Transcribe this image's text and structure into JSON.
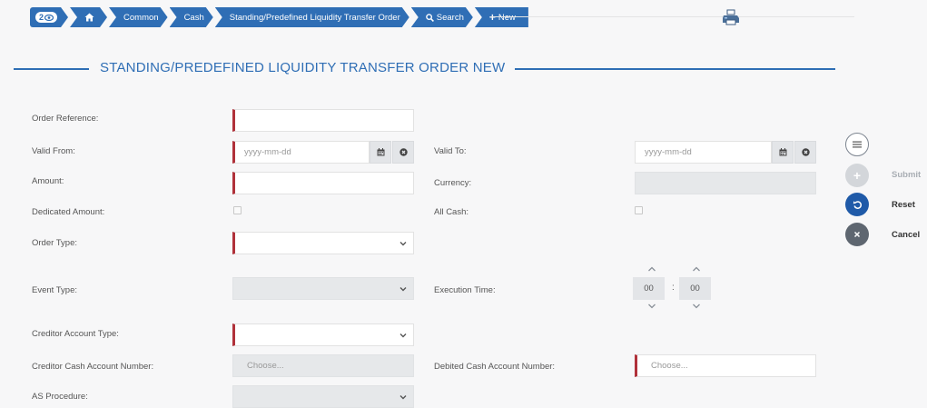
{
  "breadcrumb": {
    "counter": "2",
    "items": [
      "Common",
      "Cash",
      "Standing/Predefined Liquidity Transfer Order",
      "Search",
      "New"
    ]
  },
  "page": {
    "title": "STANDING/PREDEFINED LIQUIDITY TRANSFER ORDER NEW"
  },
  "form": {
    "order_reference": {
      "label": "Order Reference:",
      "value": ""
    },
    "valid_from": {
      "label": "Valid From:",
      "placeholder": "yyyy-mm-dd"
    },
    "valid_to": {
      "label": "Valid To:",
      "placeholder": "yyyy-mm-dd"
    },
    "amount": {
      "label": "Amount:",
      "value": ""
    },
    "currency": {
      "label": "Currency:",
      "value": ""
    },
    "dedicated_amount": {
      "label": "Dedicated Amount:",
      "checked": false
    },
    "all_cash": {
      "label": "All Cash:",
      "checked": false
    },
    "order_type": {
      "label": "Order Type:",
      "value": ""
    },
    "event_type": {
      "label": "Event Type:",
      "value": ""
    },
    "execution_time": {
      "label": "Execution Time:",
      "hours": "00",
      "separator": ":",
      "minutes": "00"
    },
    "creditor_account_type": {
      "label": "Creditor Account Type:",
      "value": ""
    },
    "creditor_cash_account_number": {
      "label": "Creditor Cash Account Number:",
      "placeholder": "Choose..."
    },
    "debited_cash_account_number": {
      "label": "Debited Cash Account Number:",
      "placeholder": "Choose..."
    },
    "as_procedure": {
      "label": "AS Procedure:",
      "value": ""
    }
  },
  "actions": {
    "submit": "Submit",
    "reset": "Reset",
    "cancel": "Cancel"
  },
  "colors": {
    "primary": "#2f6eb5",
    "required": "#b0313a",
    "reset": "#1f5aa8",
    "cancel": "#5e6670"
  }
}
